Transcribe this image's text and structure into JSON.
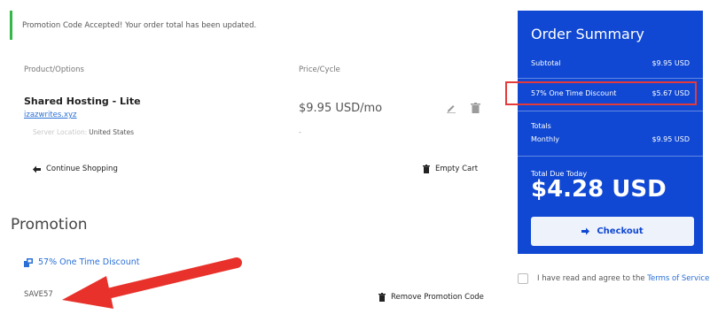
{
  "alert": {
    "message": "Promotion Code Accepted! Your order total has been updated."
  },
  "cart": {
    "headers": {
      "product": "Product/Options",
      "price": "Price/Cycle"
    },
    "item": {
      "name": "Shared Hosting - Lite",
      "domain": "izazwrites.xyz",
      "server_label": "Server Location:",
      "server_value": "United States",
      "price": "$9.95 USD/mo",
      "option_price": "-"
    },
    "continue_label": "Continue Shopping",
    "empty_label": "Empty Cart"
  },
  "promotion": {
    "heading": "Promotion",
    "name": "57% One Time Discount",
    "code": "SAVE57",
    "remove_label": "Remove Promotion Code"
  },
  "summary": {
    "title": "Order Summary",
    "subtotal_label": "Subtotal",
    "subtotal_value": "$9.95 USD",
    "discount_label": "57% One Time Discount",
    "discount_value": "$5.67 USD",
    "totals_label": "Totals",
    "monthly_label": "Monthly",
    "monthly_value": "$9.95 USD",
    "due_label": "Total Due Today",
    "due_value": "$4.28 USD",
    "checkout_label": "Checkout"
  },
  "tos": {
    "text": "I have read and agree to the",
    "link": "Terms of Service"
  },
  "colors": {
    "summary_bg": "#1048d3",
    "highlight": "#e43a3a",
    "arrow": "#e8312a",
    "alert_border": "#35b847"
  },
  "icons": [
    "edit-icon",
    "trash-icon",
    "arrow-left-icon",
    "promo-tag-icon",
    "arrow-right-icon"
  ]
}
